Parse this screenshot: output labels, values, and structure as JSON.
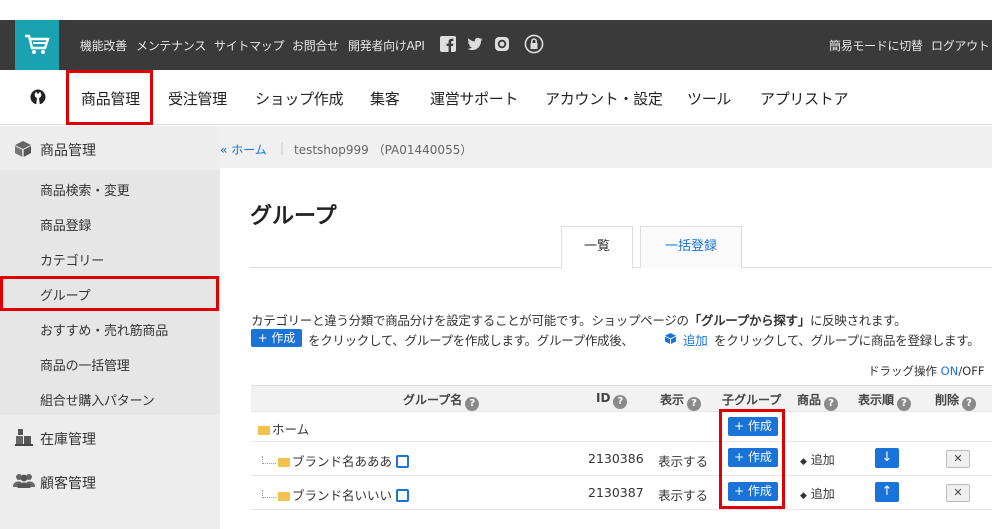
{
  "header": {
    "links": [
      "機能改善",
      "メンテナンス",
      "サイトマップ",
      "お問合せ",
      "開発者向けAPI"
    ],
    "social_icons": [
      "facebook-icon",
      "twitter-icon",
      "instagram-icon",
      "lock-icon"
    ],
    "mode_switch": "簡易モードに切替",
    "logout": "ログアウト"
  },
  "nav": {
    "items": [
      "商品管理",
      "受注管理",
      "ショップ作成",
      "集客",
      "運営サポート",
      "アカウント・設定",
      "ツール",
      "アプリストア"
    ]
  },
  "sidebar": {
    "section1": "商品管理",
    "items": [
      "商品検索・変更",
      "商品登録",
      "カテゴリー",
      "グループ",
      "おすすめ・売れ筋商品",
      "商品の一括管理",
      "組合せ購入パターン"
    ],
    "section2": "在庫管理",
    "section3": "顧客管理"
  },
  "breadcrumb": {
    "home": "« ホーム",
    "shop": "testshop999 （PA01440055）"
  },
  "page": {
    "title": "グループ",
    "tabs": [
      "一覧",
      "一括登録"
    ],
    "desc1_pre": "カテゴリーと違う分類で商品分けを設定することが可能です。ショップページの",
    "desc1_bold": "「グループから探す」",
    "desc1_post": "に反映されます。",
    "create_btn": "+ 作成",
    "desc2_a": "をクリックして、グループを作成します。グループ作成後、",
    "add_link": "追加",
    "desc2_b": "をクリックして、グループに商品を登録します。",
    "drag_label": "ドラッグ操作",
    "drag_on": "ON",
    "drag_off": "/OFF"
  },
  "table": {
    "headers": [
      "グループ名",
      "ID",
      "表示",
      "子グループ",
      "商品",
      "表示順",
      "削除"
    ],
    "rows": [
      {
        "name": "ホーム",
        "id": "",
        "display": "",
        "child": "+ 作成",
        "product": "",
        "order": "",
        "delete": ""
      },
      {
        "name": "ブランド名あああ",
        "id": "2130386",
        "display": "表示する",
        "child": "+ 作成",
        "product": "追加",
        "order": "↓",
        "delete": "✕"
      },
      {
        "name": "ブランド名いいい",
        "id": "2130387",
        "display": "表示する",
        "child": "+ 作成",
        "product": "追加",
        "order": "↑",
        "delete": "✕"
      }
    ]
  },
  "colors": {
    "topbar": "#3a3a3a",
    "cart": "#1aa2b3",
    "accent": "#1a73d9",
    "highlight": "#e00000"
  }
}
